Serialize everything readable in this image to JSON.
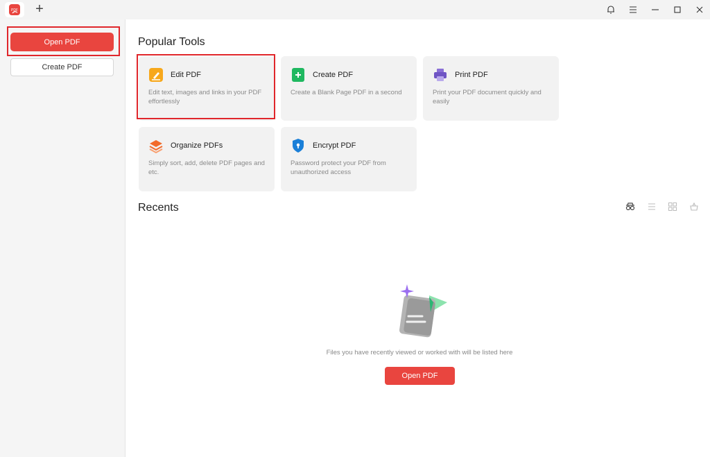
{
  "titlebar": {
    "logo_text": "PDF",
    "new_tab_label": "+"
  },
  "sidebar": {
    "open_label": "Open PDF",
    "create_label": "Create PDF"
  },
  "popular_tools": {
    "title": "Popular Tools",
    "cards": [
      {
        "title": "Edit PDF",
        "desc": "Edit text, images and links in your PDF effortlessly"
      },
      {
        "title": "Create PDF",
        "desc": "Create a Blank Page PDF in a second"
      },
      {
        "title": "Print PDF",
        "desc": "Print your PDF document quickly and easily"
      },
      {
        "title": "Organize PDFs",
        "desc": "Simply sort, add, delete PDF pages and etc."
      },
      {
        "title": "Encrypt PDF",
        "desc": "Password protect your PDF from unauthorized access"
      }
    ]
  },
  "recents": {
    "title": "Recents",
    "empty_text": "Files you have recently viewed or worked with will be listed here",
    "open_label": "Open PDF"
  },
  "colors": {
    "accent": "#e9453f",
    "highlight": "#e0262b",
    "card_bg": "#f2f2f2"
  },
  "icons": {
    "titlebar": [
      "bell-icon",
      "menu-icon",
      "minimize-icon",
      "maximize-icon",
      "close-icon"
    ],
    "cards": [
      "edit-pencil-icon",
      "plus-document-icon",
      "printer-icon",
      "layers-icon",
      "shield-lock-icon"
    ],
    "views": [
      "glasses-icon",
      "list-view-icon",
      "grid-view-icon",
      "basket-icon"
    ]
  }
}
